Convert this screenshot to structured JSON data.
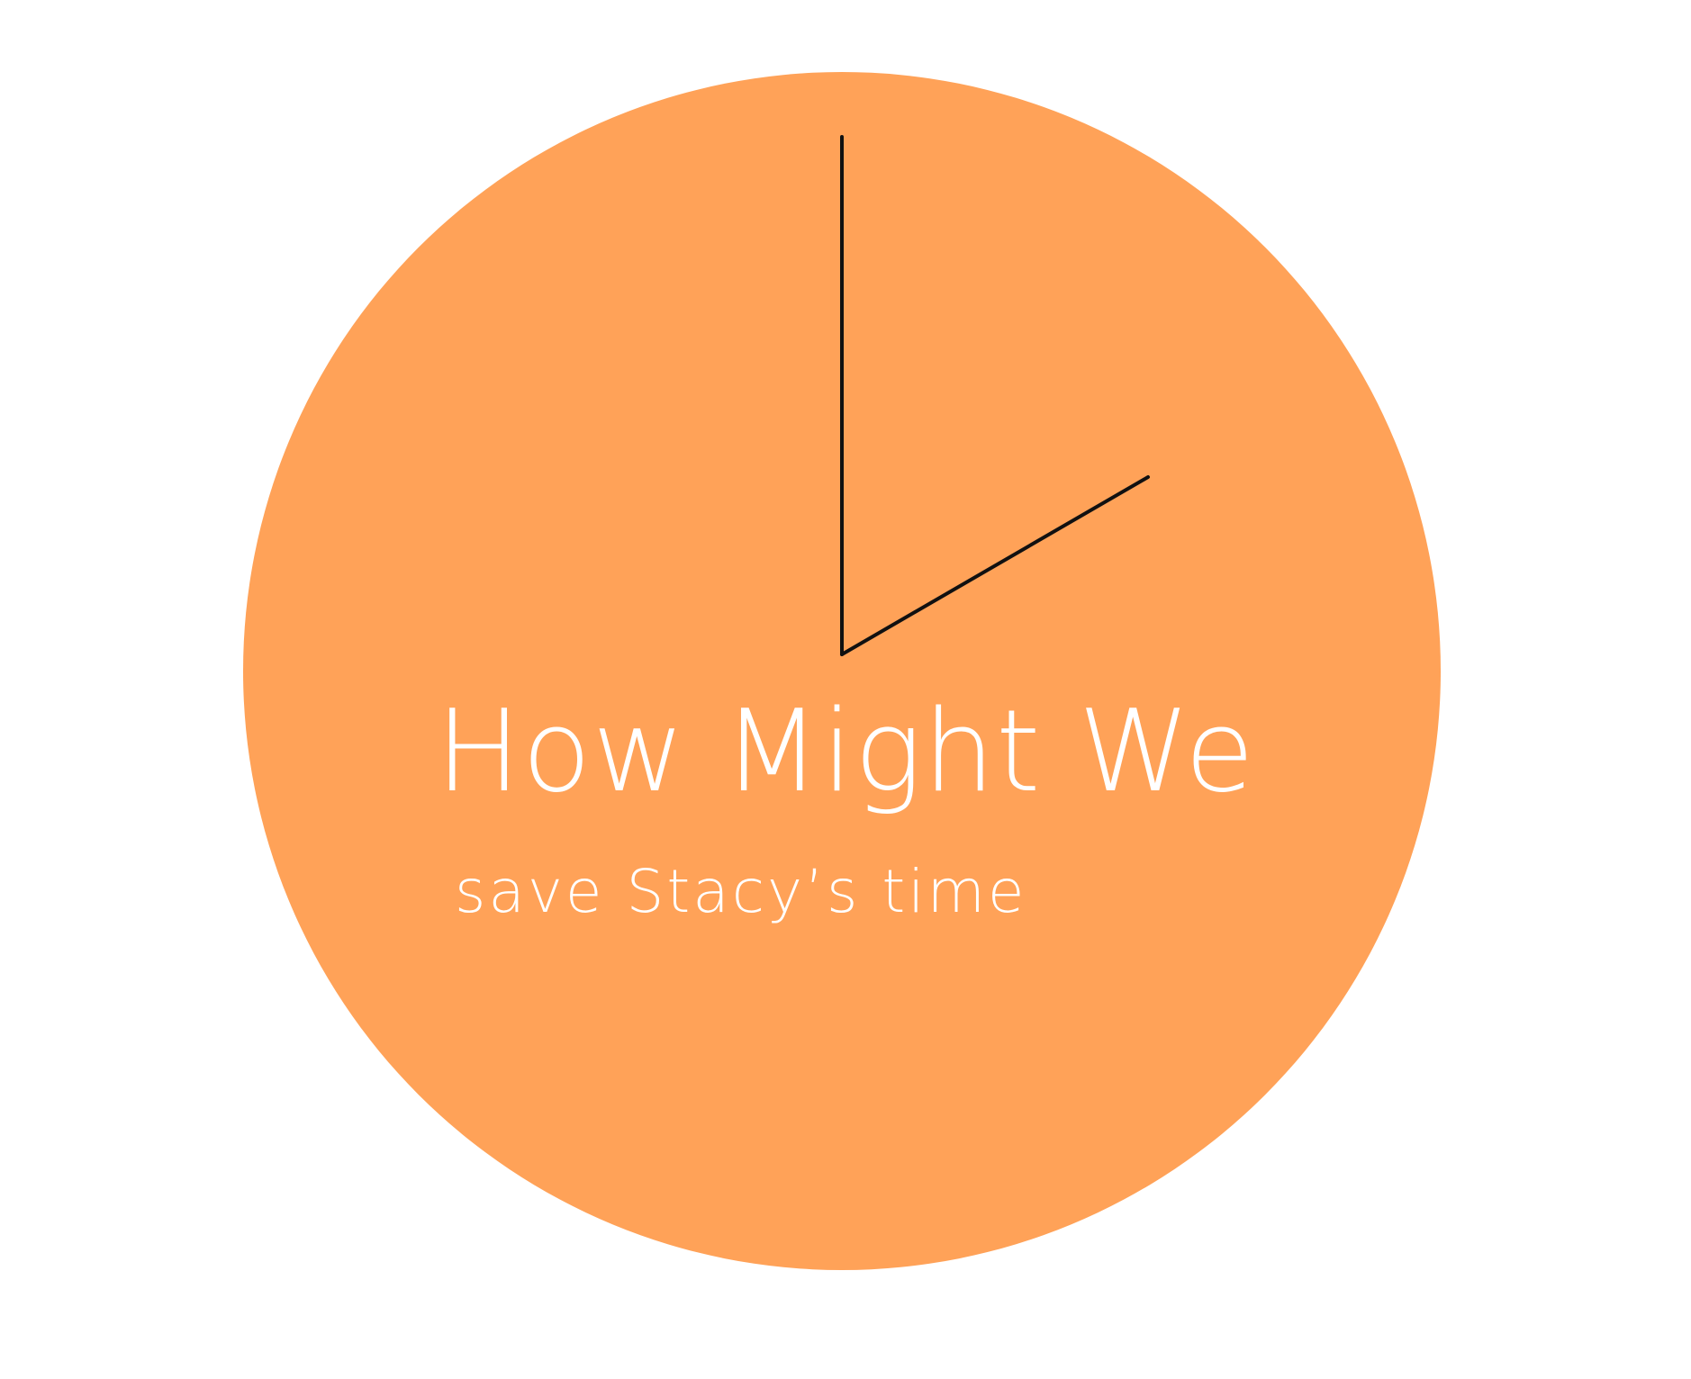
{
  "card": {
    "title": "How Might We",
    "subtitle": "save Stacy’s time"
  },
  "colors": {
    "clock_face": "#ffa258",
    "hands": "#111111",
    "text": "#ffffff",
    "background": "#ffffff"
  },
  "icon": "clock-icon"
}
